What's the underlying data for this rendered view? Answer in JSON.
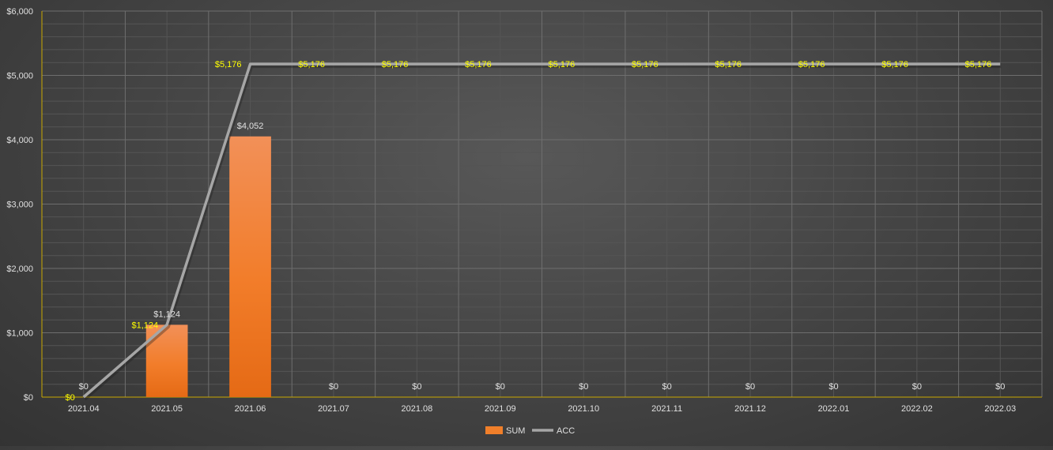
{
  "chart_data": {
    "type": "bar",
    "title": "",
    "xlabel": "",
    "ylabel": "",
    "categories": [
      "2021.04",
      "2021.05",
      "2021.06",
      "2021.07",
      "2021.08",
      "2021.09",
      "2021.10",
      "2021.11",
      "2021.12",
      "2022.01",
      "2022.02",
      "2022.03"
    ],
    "series": [
      {
        "name": "SUM",
        "type": "bar",
        "values": [
          0,
          1124,
          4052,
          0,
          0,
          0,
          0,
          0,
          0,
          0,
          0,
          0
        ],
        "labels": [
          "$0",
          "$1,124",
          "$4,052",
          "$0",
          "$0",
          "$0",
          "$0",
          "$0",
          "$0",
          "$0",
          "$0",
          "$0"
        ],
        "color": "#f07f2a"
      },
      {
        "name": "ACC",
        "type": "line",
        "values": [
          0,
          1124,
          5176,
          5176,
          5176,
          5176,
          5176,
          5176,
          5176,
          5176,
          5176,
          5176
        ],
        "labels": [
          "$0",
          "$1,124",
          "$5,176",
          "$5,176",
          "$5,176",
          "$5,176",
          "$5,176",
          "$5,176",
          "$5,176",
          "$5,176",
          "$5,176",
          "$5,176"
        ],
        "color": "#a6a6a6",
        "label_color": "#ffff00"
      }
    ],
    "ylim": [
      0,
      6000
    ],
    "yticks": [
      0,
      1000,
      2000,
      3000,
      4000,
      5000,
      6000
    ],
    "ytick_labels": [
      "$0",
      "$1,000",
      "$2,000",
      "$3,000",
      "$4,000",
      "$5,000",
      "$6,000"
    ],
    "grid": true,
    "legend_position": "bottom",
    "colors": {
      "axis": "#c9a800",
      "grid_major": "#6e6e6e",
      "grid_minor": "#555555",
      "tick_text": "#e0e0e0",
      "bar_label": "#e0e0e0"
    }
  }
}
